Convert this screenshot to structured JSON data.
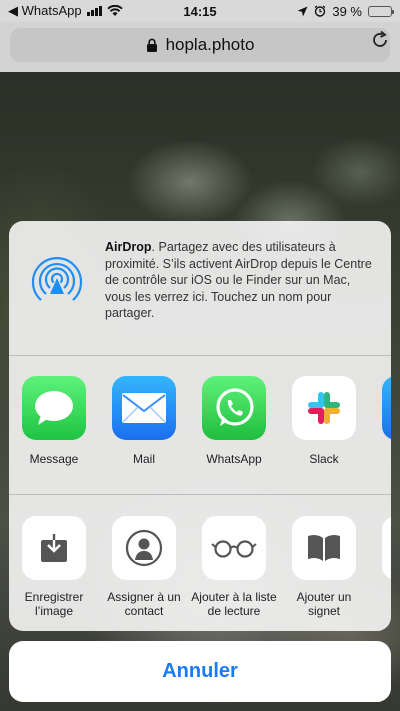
{
  "status_bar": {
    "app_back": "◀ WhatsApp",
    "time": "14:15",
    "battery_percent": "39 %",
    "battery_level": 0.39,
    "battery_color": "#f5c518"
  },
  "browser": {
    "url": "hopla.photo"
  },
  "share_sheet": {
    "airdrop": {
      "title": "AirDrop",
      "description": ". Partagez avec des utilisateurs à proximité. S’ils activent AirDrop depuis le Centre de contrôle sur iOS ou le Finder sur un Mac, vous les verrez ici. Touchez un nom pour partager."
    },
    "apps": [
      {
        "label": "Message",
        "icon": "messages-icon"
      },
      {
        "label": "Mail",
        "icon": "mail-icon"
      },
      {
        "label": "WhatsApp",
        "icon": "whatsapp-icon"
      },
      {
        "label": "Slack",
        "icon": "slack-icon"
      },
      {
        "label": "",
        "icon": "partial-app-icon"
      }
    ],
    "actions": [
      {
        "label": "Enregistrer l’image",
        "icon": "save-image-icon"
      },
      {
        "label": "Assigner à un contact",
        "icon": "contact-icon"
      },
      {
        "label": "Ajouter à la liste de lecture",
        "icon": "reading-list-icon"
      },
      {
        "label": "Ajouter un signet",
        "icon": "bookmark-icon"
      },
      {
        "label": "",
        "icon": "partial-action-icon"
      }
    ],
    "cancel_label": "Annuler"
  },
  "colors": {
    "accent": "#1a7cf3",
    "messages_green": "#2ed158",
    "mail_blue": "#1f8ef5",
    "whatsapp_green": "#28c840"
  }
}
